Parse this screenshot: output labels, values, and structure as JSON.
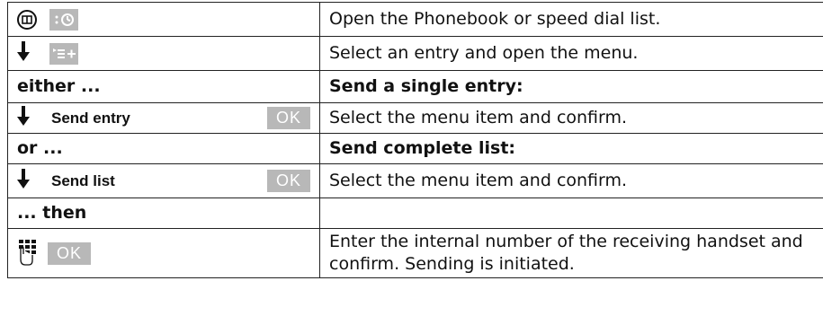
{
  "rows": [
    {
      "id": "open-phonebook",
      "left_icons": [
        "phonebook-key-icon",
        "speed-dial-icon"
      ],
      "right": "Open the Phonebook or speed dial list."
    },
    {
      "id": "select-entry",
      "left_icons": [
        "down-arrow-icon",
        "menu-icon"
      ],
      "right": "Select an entry and open the menu."
    },
    {
      "id": "either",
      "left": "either ...",
      "right": "Send a single entry:"
    },
    {
      "id": "send-entry",
      "left": "Send entry",
      "ok": "OK",
      "right": "Select the menu item and confirm."
    },
    {
      "id": "or",
      "left": "or ...",
      "right": "Send complete list:"
    },
    {
      "id": "send-list",
      "left": "Send list",
      "ok": "OK",
      "right": "Select the menu item and confirm."
    },
    {
      "id": "then",
      "left": "... then",
      "right": ""
    },
    {
      "id": "enter-number",
      "left_icons": [
        "keypad-icon"
      ],
      "ok": "OK",
      "right": "Enter the internal number of the receiving handset and confirm. Sending is initiated."
    }
  ],
  "colors": {
    "softkey_bg": "#b8b8b8",
    "border": "#222222"
  }
}
